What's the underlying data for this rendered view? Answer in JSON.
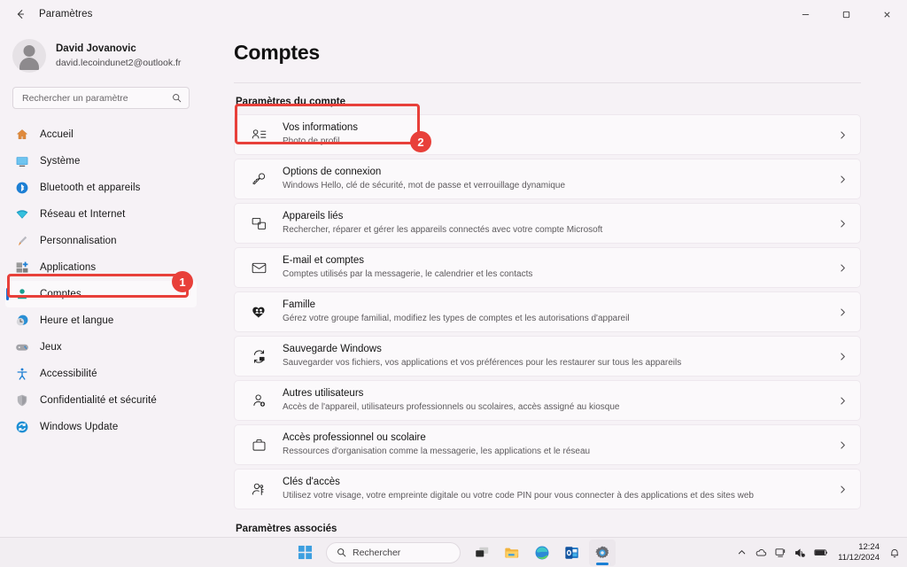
{
  "window": {
    "back_icon": "back-arrow-icon",
    "title": "Paramètres",
    "minimize_label": "—",
    "maximize_label": "❐",
    "close_label": "✕"
  },
  "sidebar": {
    "profile": {
      "name": "David Jovanovic",
      "email": "david.lecoindunet2@outlook.fr",
      "avatar_icon": "user-avatar-icon"
    },
    "search": {
      "placeholder": "Rechercher un paramètre",
      "icon": "search-icon"
    },
    "items": [
      {
        "label": "Accueil",
        "icon": "home-icon",
        "selected": false
      },
      {
        "label": "Système",
        "icon": "system-icon",
        "selected": false
      },
      {
        "label": "Bluetooth et appareils",
        "icon": "bluetooth-icon",
        "selected": false
      },
      {
        "label": "Réseau et Internet",
        "icon": "wifi-icon",
        "selected": false
      },
      {
        "label": "Personnalisation",
        "icon": "brush-icon",
        "selected": false
      },
      {
        "label": "Applications",
        "icon": "apps-icon",
        "selected": false
      },
      {
        "label": "Comptes",
        "icon": "accounts-icon",
        "selected": true
      },
      {
        "label": "Heure et langue",
        "icon": "clock-globe-icon",
        "selected": false
      },
      {
        "label": "Jeux",
        "icon": "gamepad-icon",
        "selected": false
      },
      {
        "label": "Accessibilité",
        "icon": "accessibility-icon",
        "selected": false
      },
      {
        "label": "Confidentialité et sécurité",
        "icon": "shield-icon",
        "selected": false
      },
      {
        "label": "Windows Update",
        "icon": "update-icon",
        "selected": false
      }
    ]
  },
  "main": {
    "page_title": "Comptes",
    "section_title": "Paramètres du compte",
    "related_title": "Paramètres associés",
    "chevron_icon": "chevron-right-icon",
    "rows": [
      {
        "title": "Vos informations",
        "sub": "Photo de profil",
        "icon": "your-info-icon"
      },
      {
        "title": "Options de connexion",
        "sub": "Windows Hello, clé de sécurité, mot de passe et verrouillage dynamique",
        "icon": "key-icon"
      },
      {
        "title": "Appareils liés",
        "sub": "Rechercher, réparer et gérer les appareils connectés avec votre compte Microsoft",
        "icon": "linked-devices-icon"
      },
      {
        "title": "E-mail et comptes",
        "sub": "Comptes utilisés par la messagerie, le calendrier et les contacts",
        "icon": "envelope-icon"
      },
      {
        "title": "Famille",
        "sub": "Gérez votre groupe familial, modifiez les types de comptes et les autorisations d'appareil",
        "icon": "family-heart-icon"
      },
      {
        "title": "Sauvegarde Windows",
        "sub": "Sauvegarder vos fichiers, vos applications et vos préférences pour les restaurer sur tous les appareils",
        "icon": "backup-icon"
      },
      {
        "title": "Autres utilisateurs",
        "sub": "Accès de l'appareil, utilisateurs professionnels ou scolaires, accès assigné au kiosque",
        "icon": "other-users-icon"
      },
      {
        "title": "Accès professionnel ou scolaire",
        "sub": "Ressources d'organisation comme la messagerie, les applications et le réseau",
        "icon": "briefcase-icon"
      },
      {
        "title": "Clés d'accès",
        "sub": "Utilisez votre visage, votre empreinte digitale ou votre code PIN pour vous connecter à des applications et des sites web",
        "icon": "passkey-icon"
      }
    ]
  },
  "annotations": {
    "accent_color": "#e8403a",
    "badges": [
      {
        "number": "1",
        "target": "sidebar-item-comptes"
      },
      {
        "number": "2",
        "target": "row-vos-informations"
      }
    ]
  },
  "taskbar": {
    "start_label": "start-icon",
    "search": {
      "label": "Rechercher",
      "icon": "search-icon"
    },
    "apps": [
      {
        "name": "task-view-icon",
        "active": false
      },
      {
        "name": "file-explorer-icon",
        "active": false
      },
      {
        "name": "edge-browser-icon",
        "active": false
      },
      {
        "name": "outlook-icon",
        "active": false
      },
      {
        "name": "settings-icon",
        "active": true
      }
    ],
    "tray": {
      "chevron_icon": "chevron-up-icon",
      "onedrive_icon": "cloud-icon",
      "network_icon": "network-icon",
      "volume_icon": "volume-icon",
      "battery_icon": "battery-icon",
      "notification_icon": "bell-icon",
      "time": "12:24",
      "date": "11/12/2024"
    }
  }
}
